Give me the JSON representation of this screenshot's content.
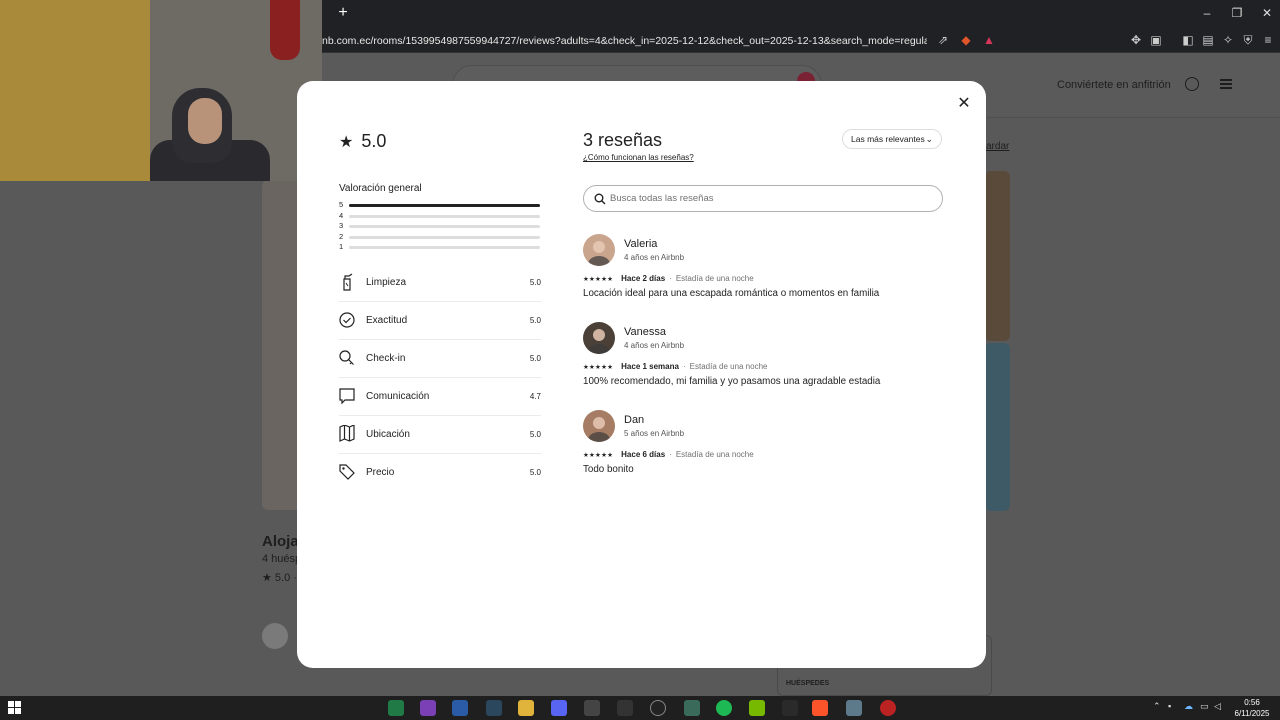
{
  "browser": {
    "new_tab": "+",
    "url": "nb.com.ec/rooms/1539954987559944727/reviews?adults=4&check_in=2025-12-12&check_out=2025-12-13&search_mode=regular_search&sou...",
    "window_controls": [
      "–",
      "❐",
      "✕"
    ]
  },
  "page": {
    "host_link": "Conviértete en anfitrión",
    "save_link": "ardar",
    "title_partial": "Aloja",
    "guests_partial": "4 huésp",
    "rating_partial": "★ 5.0 · 2",
    "guests_box_label": "HUÉSPEDES"
  },
  "modal": {
    "close": "✕",
    "overall_score": "5.0",
    "overall_label": "Valoración general",
    "distribution": [
      {
        "stars": "5",
        "fraction": 1.0
      },
      {
        "stars": "4",
        "fraction": 0
      },
      {
        "stars": "3",
        "fraction": 0
      },
      {
        "stars": "2",
        "fraction": 0
      },
      {
        "stars": "1",
        "fraction": 0
      }
    ],
    "categories": [
      {
        "label": "Limpieza",
        "value": "5.0",
        "icon": "spray-bottle-icon"
      },
      {
        "label": "Exactitud",
        "value": "5.0",
        "icon": "check-circle-icon"
      },
      {
        "label": "Check-in",
        "value": "5.0",
        "icon": "key-icon"
      },
      {
        "label": "Comunicación",
        "value": "4.7",
        "icon": "chat-bubble-icon"
      },
      {
        "label": "Ubicación",
        "value": "5.0",
        "icon": "map-icon"
      },
      {
        "label": "Precio",
        "value": "5.0",
        "icon": "price-tag-icon"
      }
    ],
    "reviews_title": "3 reseñas",
    "reviews_help": "¿Cómo funcionan las reseñas?",
    "sort_label": "Las más relevantes",
    "search_placeholder": "Busca todas las reseñas",
    "search_value": "",
    "reviews": [
      {
        "name": "Valeria",
        "tenure": "4 años en Airbnb",
        "stars": "★★★★★",
        "date": "Hace 2 días",
        "stay": "Estadía de una noche",
        "text": "Locación ideal para una escapada romántica o momentos en familia",
        "avatar_color": "#c9a58e"
      },
      {
        "name": "Vanessa",
        "tenure": "4 años en Airbnb",
        "stars": "★★★★★",
        "date": "Hace 1 semana",
        "stay": "Estadía de una noche",
        "text": "100% recomendado, mi familia y yo pasamos una agradable estadia",
        "avatar_color": "#4a4038"
      },
      {
        "name": "Dan",
        "tenure": "5 años en Airbnb",
        "stars": "★★★★★",
        "date": "Hace 6 días",
        "stay": "Estadía de una noche",
        "text": "Todo bonito",
        "avatar_color": "#a67c64"
      }
    ]
  },
  "taskbar": {
    "time": "0:56",
    "date": "6/11/2025"
  },
  "colors": {
    "text": "#222222",
    "muted": "#717171",
    "divider": "#ebebeb"
  }
}
